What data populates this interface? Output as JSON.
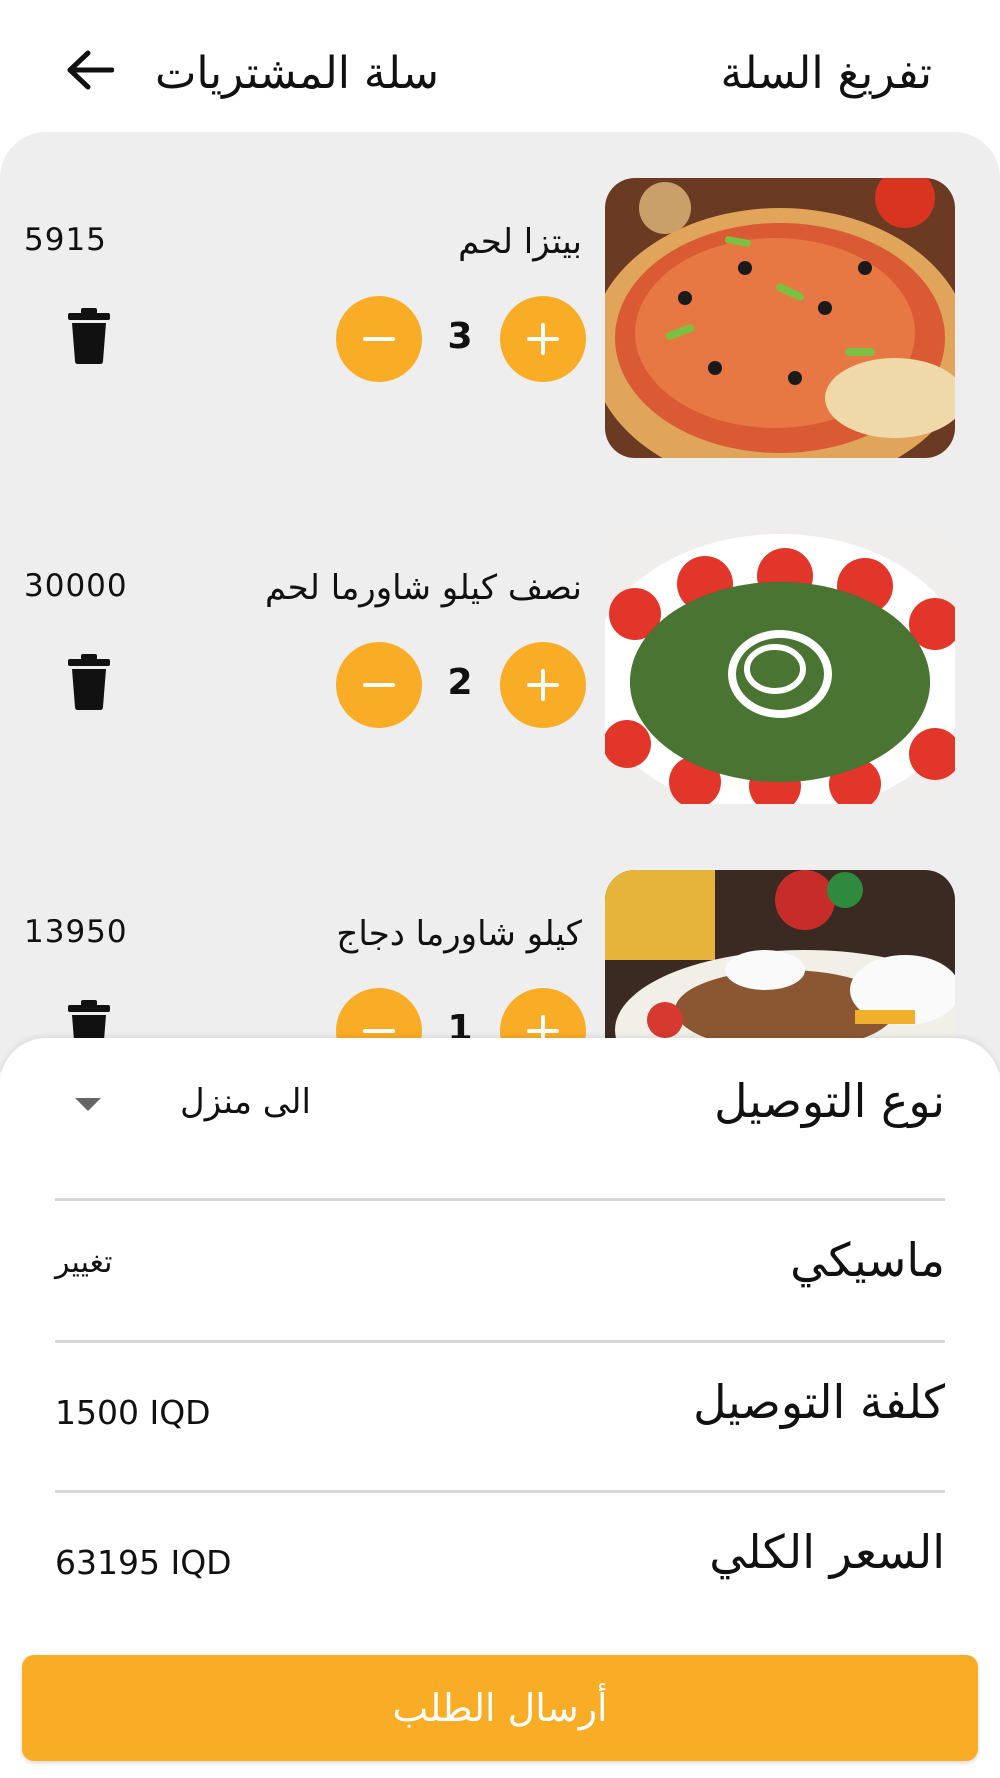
{
  "header": {
    "title": "سلة المشتريات",
    "clear_cart": "تفريغ السلة"
  },
  "items": [
    {
      "name": "بيتزا لحم",
      "price": "5915",
      "quantity": "3",
      "image": "pizza"
    },
    {
      "name": "نصف كيلو شاورما لحم",
      "price": "30000",
      "quantity": "2",
      "image": "shawarma-meat"
    },
    {
      "name": "كيلو شاورما دجاج",
      "price": "13950",
      "quantity": "1",
      "image": "shawarma-chicken"
    }
  ],
  "summary": {
    "delivery_type_label": "نوع التوصيل",
    "delivery_type_value": "الى منزل",
    "location_label": "ماسيكي",
    "change_label": "تغيير",
    "delivery_cost_label": "كلفة التوصيل",
    "delivery_cost_value": "1500 IQD",
    "total_label": "السعر الكلي",
    "total_value": "63195 IQD"
  },
  "submit_label": "أرسال الطلب",
  "colors": {
    "accent": "#f9ac25",
    "cart_background": "#eeeeee"
  },
  "icons": {
    "back": "arrow-left-icon",
    "trash": "trash-icon",
    "plus": "plus-icon",
    "minus": "minus-icon",
    "dropdown": "caret-down-icon"
  }
}
